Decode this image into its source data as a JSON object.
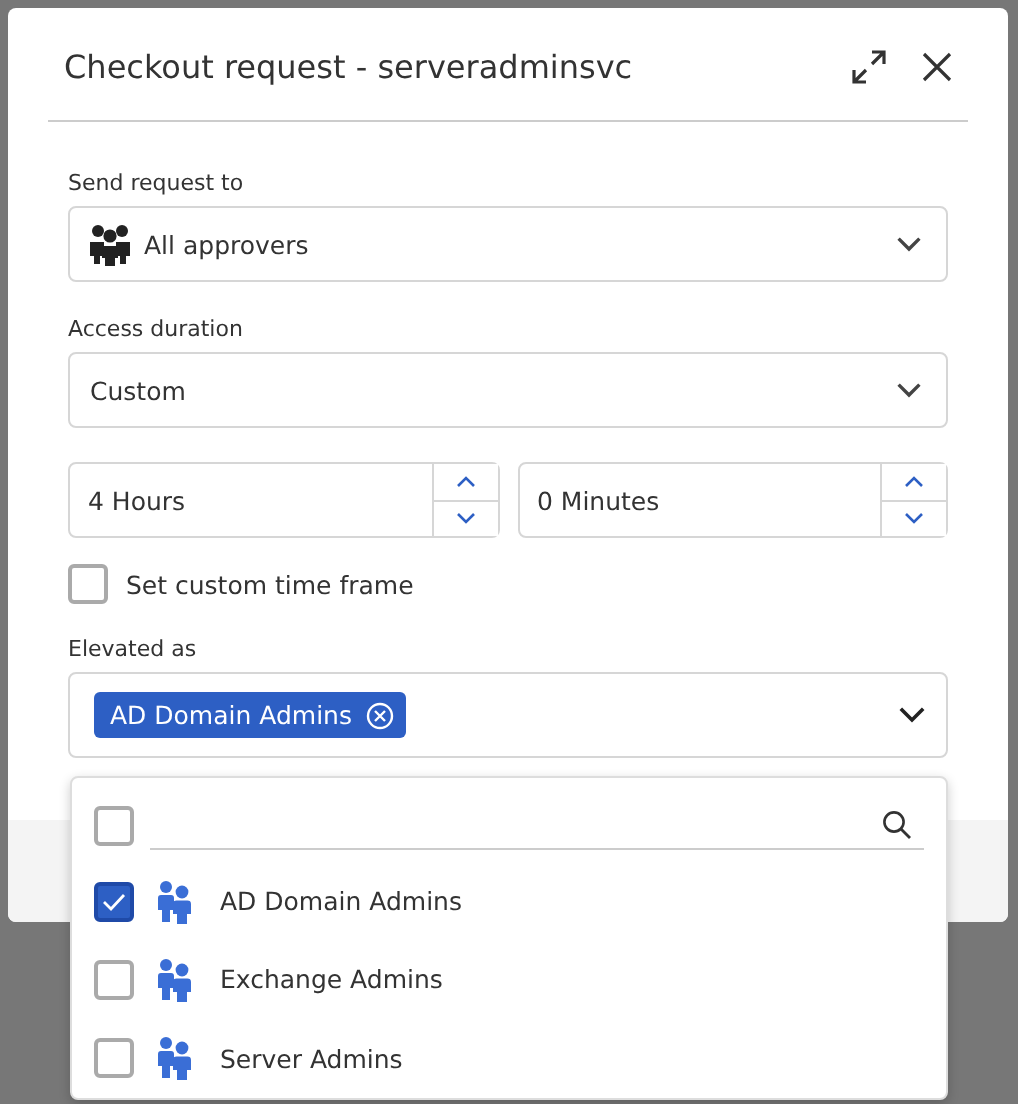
{
  "dialog": {
    "title": "Checkout request - serveradminsvc",
    "send_request_to": {
      "label": "Send request to",
      "value": "All approvers"
    },
    "access_duration": {
      "label": "Access duration",
      "value": "Custom"
    },
    "duration": [
      {
        "value": "4 Hours"
      },
      {
        "value": "0 Minutes"
      }
    ],
    "custom_time_frame": {
      "label": "Set custom time frame",
      "checked": false
    },
    "elevated_as": {
      "label": "Elevated as",
      "tags": [
        {
          "label": "AD Domain Admins"
        }
      ],
      "expanded": true,
      "select_all_checked": false,
      "options": [
        {
          "label": "AD Domain Admins",
          "checked": true
        },
        {
          "label": "Exchange Admins",
          "checked": false
        },
        {
          "label": "Server Admins",
          "checked": false
        }
      ]
    }
  }
}
